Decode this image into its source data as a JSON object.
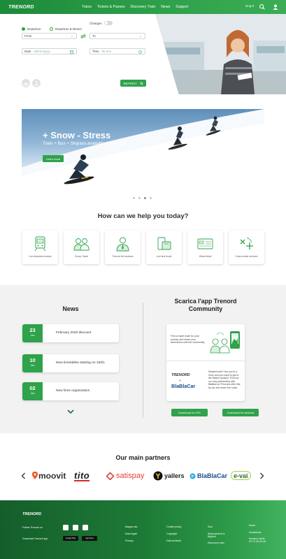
{
  "header": {
    "logo": "TRENORD",
    "nav": [
      "Trains",
      "Tickets & Passes",
      "Discovery Train",
      "News",
      "Support"
    ],
    "lang": "Eng ▾"
  },
  "search": {
    "trip_types": [
      "Departure",
      "Departure & Return"
    ],
    "changes_label": "Changes",
    "from_label": "From",
    "to_label": "To",
    "date_label": "Date",
    "date_placeholder": "dd/mm/yyyy",
    "time_label": "Time",
    "time_placeholder": "hh:mm",
    "search_button": "SEARCH"
  },
  "banner": {
    "title": "+ Snow - Stress",
    "subtitle": "Train + Bus + Skipass available from 34 €",
    "button": "Learn more"
  },
  "help": {
    "title": "How can we help you today?",
    "items": [
      {
        "label": "Live departure boards",
        "icon": "board-icon"
      },
      {
        "label": "Group Travel",
        "icon": "group-icon"
      },
      {
        "label": "Trenord for business",
        "icon": "business-icon"
      },
      {
        "label": "Lost and found",
        "icon": "lost-found-icon"
      },
      {
        "label": "Virtual ticket",
        "icon": "ticket-icon"
      },
      {
        "label": "Cross-border services",
        "icon": "cross-border-icon"
      }
    ]
  },
  "news": {
    "title": "News",
    "items": [
      {
        "day": "23",
        "month": "Jan",
        "text": "February 2020 discount"
      },
      {
        "day": "10",
        "month": "Jan",
        "text": "New timetables starting on 15/01"
      },
      {
        "day": "02",
        "month": "Jan",
        "text": "New lines organization"
      }
    ]
  },
  "app": {
    "title_line1": "Scarica l'app Trenord",
    "title_line2": "Community",
    "promo1": "Find a travel mate for your journey and share your adventures with the community.",
    "promo2": "Delated train? Are you in a hurry and you want to get to the station quickly? Find out our new partnership with BlaBlaCar! Find and offer lifts by car and share the costs.",
    "trenord_logo": "TRENORD",
    "plus": "+",
    "blablacar_logo": "BlaBlaCar",
    "ios_button": "Download for IOS",
    "android_button": "Download for Android"
  },
  "partners": {
    "title": "Our main partners",
    "logos": [
      "moovit",
      "tito",
      "satispay",
      "yallers",
      "BlaBlaCar",
      "e-vai"
    ]
  },
  "footer": {
    "logo": "TRENORD",
    "follow": "Follow Trenord on",
    "download": "Download Trenord app",
    "store_badges": [
      "Google Play",
      "App Store"
    ],
    "col1": [
      "Mappa sito",
      "Note legali",
      "Privacy"
    ],
    "col2": [
      "Cookie policy",
      "Copyright",
      "Dati societari"
    ],
    "col3": [
      "Soci",
      "Abbonamenti & Biglietti",
      "Discovery train"
    ],
    "col4": [
      "News",
      "Assistenza",
      "Numero verde 02.72.49.49.49"
    ]
  },
  "colors": {
    "brand_green": "#2fa24b",
    "footer_dark": "#155e2b"
  }
}
